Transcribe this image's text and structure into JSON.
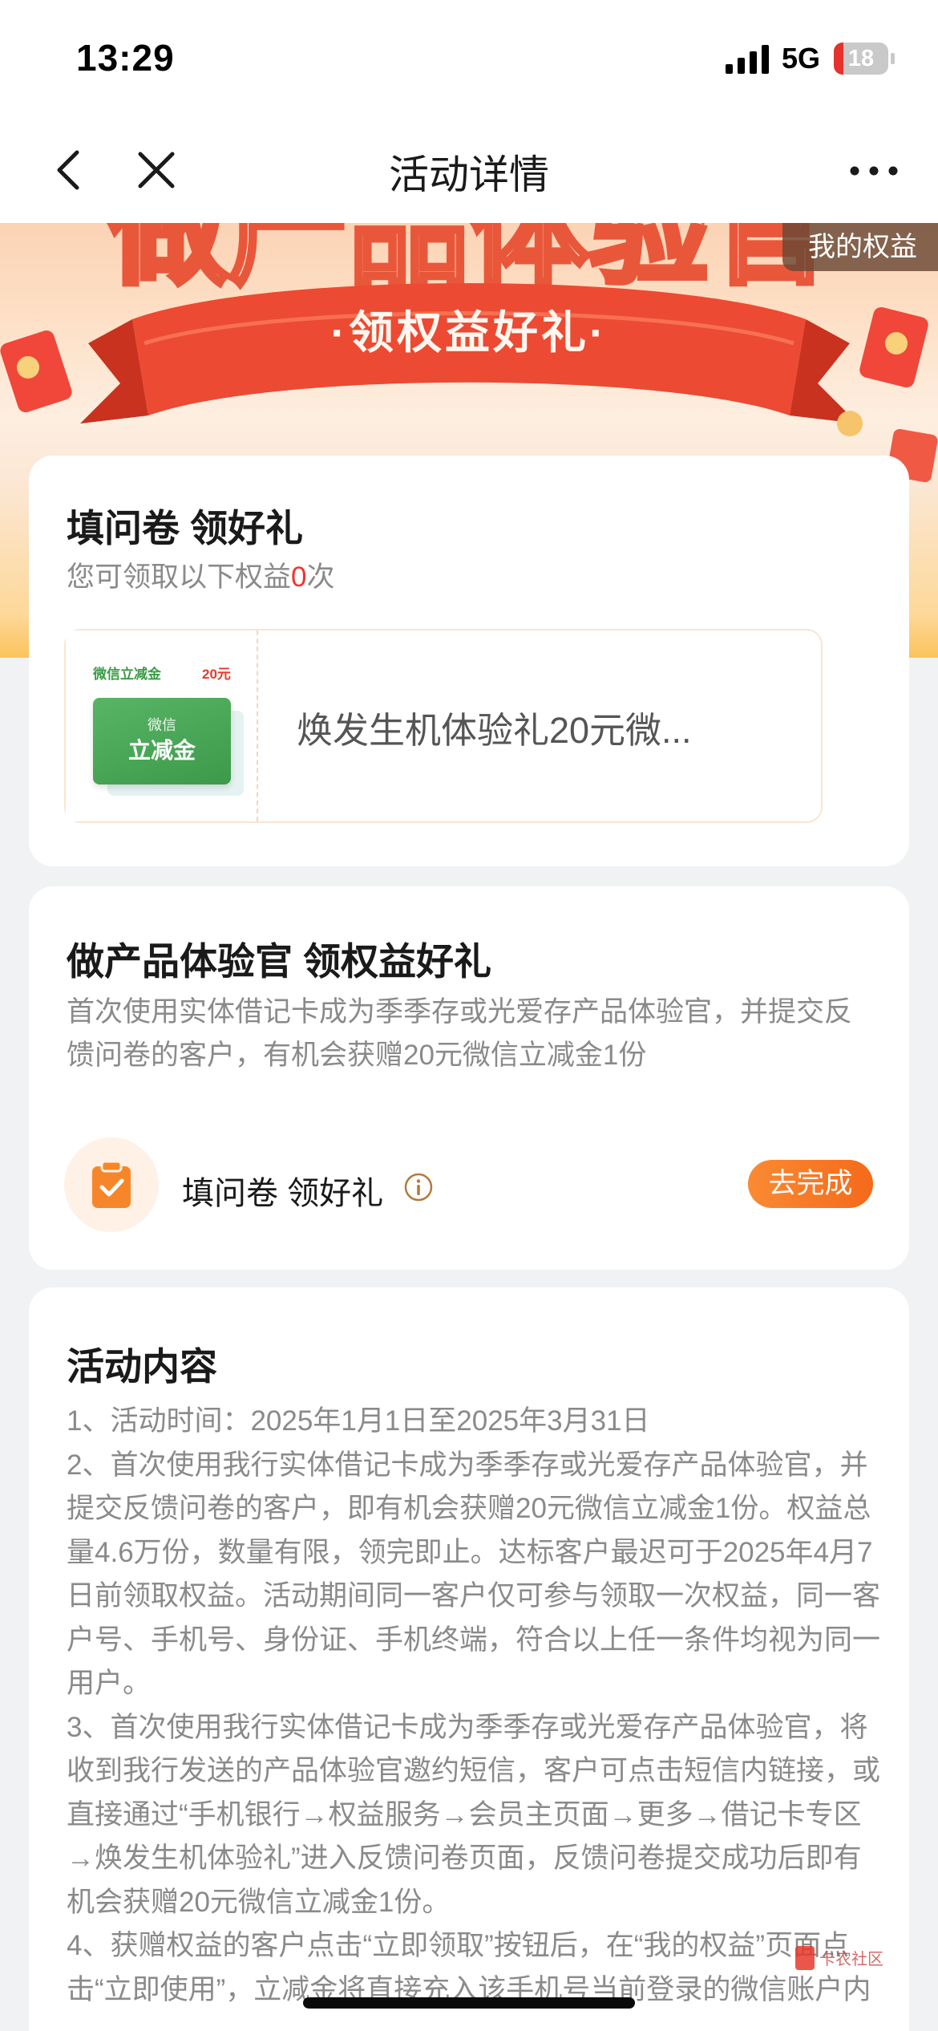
{
  "status_bar": {
    "time": "13:29",
    "network": "5G",
    "battery": "18",
    "battery_fraction": 0.18
  },
  "nav": {
    "title": "活动详情"
  },
  "banner": {
    "my_rights": "我的权益",
    "ribbon_text": "·领权益好礼·",
    "headline": "做产品体验官"
  },
  "rights_card": {
    "title": "填问卷 领好礼",
    "subtitle_prefix": "您可领取以下权益",
    "count": "0",
    "subtitle_suffix": "次",
    "coupon": {
      "label": "微信立减金",
      "amount": "20元",
      "card_top": "微信",
      "card_main": "立减金",
      "name": "焕发生机体验礼20元微..."
    }
  },
  "task_card": {
    "title": "做产品体验官 领权益好礼",
    "description": "首次使用实体借记卡成为季季存或光爱存产品体验官，并提交反馈问卷的客户，有机会获赠20元微信立减金1份",
    "task_label": "填问卷 领好礼",
    "button": "去完成"
  },
  "rules_card": {
    "title": "活动内容",
    "lines": [
      "1、活动时间：2025年1月1日至2025年3月31日",
      "2、首次使用我行实体借记卡成为季季存或光爱存产品体验官，并提交反馈问卷的客户，即有机会获赠20元微信立减金1份。权益总量4.6万份，数量有限，领完即止。达标客户最迟可于2025年4月7日前领取权益。活动期间同一客户仅可参与领取一次权益，同一客户号、手机号、身份证、手机终端，符合以上任一条件均视为同一用户。",
      "3、首次使用我行实体借记卡成为季季存或光爱存产品体验官，将收到我行发送的产品体验官邀约短信，客户可点击短信内链接，或直接通过“手机银行→权益服务→会员主页面→更多→借记卡专区→焕发生机体验礼”进入反馈问卷页面，反馈问卷提交成功后即有机会获赠20元微信立减金1份。",
      "4、获赠权益的客户点击“立即领取”按钮后，在“我的权益”页面点击“立即使用”，立减金将直接充入该手机号当前登录的微信账户内"
    ]
  },
  "watermark": {
    "text": "卡农社区"
  },
  "colors": {
    "accent": "#f46a1a",
    "red": "#e8382c",
    "green": "#3d9a4a"
  }
}
